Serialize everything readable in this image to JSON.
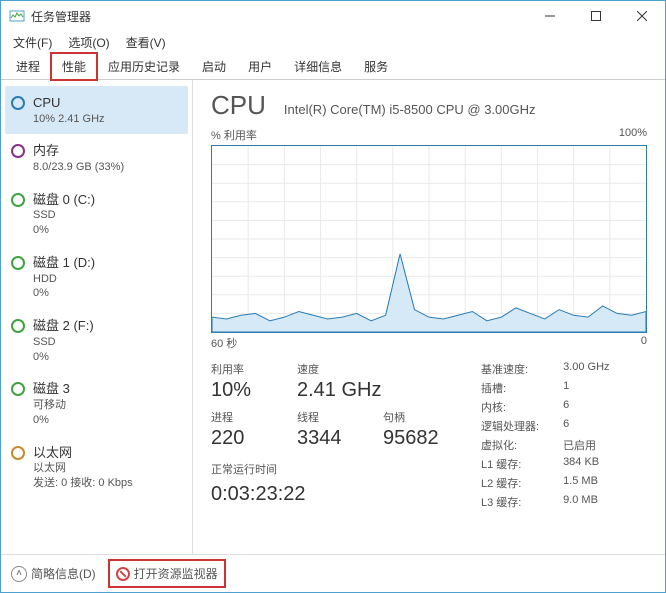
{
  "window": {
    "title": "任务管理器"
  },
  "menu": {
    "file": "文件(F)",
    "options": "选项(O)",
    "view": "查看(V)"
  },
  "tabs": {
    "processes": "进程",
    "performance": "性能",
    "apphistory": "应用历史记录",
    "startup": "启动",
    "users": "用户",
    "details": "详细信息",
    "services": "服务"
  },
  "sidebar": {
    "items": [
      {
        "title": "CPU",
        "sub": "10% 2.41 GHz",
        "color": "#2b7cb3"
      },
      {
        "title": "内存",
        "sub": "8.0/23.9 GB (33%)",
        "color": "#8a2e8a"
      },
      {
        "title": "磁盘 0 (C:)",
        "sub": "SSD",
        "sub2": "0%",
        "color": "#3fa33f"
      },
      {
        "title": "磁盘 1 (D:)",
        "sub": "HDD",
        "sub2": "0%",
        "color": "#3fa33f"
      },
      {
        "title": "磁盘 2 (F:)",
        "sub": "SSD",
        "sub2": "0%",
        "color": "#3fa33f"
      },
      {
        "title": "磁盘 3",
        "sub": "可移动",
        "sub2": "0%",
        "color": "#3fa33f"
      },
      {
        "title": "以太网",
        "sub": "以太网",
        "sub2": "发送: 0 接收: 0 Kbps",
        "color": "#c98a2b"
      }
    ]
  },
  "main": {
    "title": "CPU",
    "subtitle": "Intel(R) Core(TM) i5-8500 CPU @ 3.00GHz",
    "chart_label_left": "% 利用率",
    "chart_label_right": "100%",
    "chart_xaxis_left": "60 秒",
    "chart_xaxis_right": "0",
    "labels": {
      "util": "利用率",
      "speed": "速度",
      "procs": "进程",
      "threads": "线程",
      "handles": "句柄",
      "uptime": "正常运行时间"
    },
    "values": {
      "util": "10%",
      "speed": "2.41 GHz",
      "procs": "220",
      "threads": "3344",
      "handles": "95682",
      "uptime": "0:03:23:22"
    },
    "kvlabels": {
      "basespeed": "基准速度:",
      "sockets": "插槽:",
      "cores": "内核:",
      "logical": "逻辑处理器:",
      "virt": "虚拟化:",
      "l1": "L1 缓存:",
      "l2": "L2 缓存:",
      "l3": "L3 缓存:"
    },
    "kvvalues": {
      "basespeed": "3.00 GHz",
      "sockets": "1",
      "cores": "6",
      "logical": "6",
      "virt": "已启用",
      "l1": "384 KB",
      "l2": "1.5 MB",
      "l3": "9.0 MB"
    }
  },
  "footer": {
    "brief": "简略信息(D)",
    "resmon": "打开资源监视器"
  },
  "chart_data": {
    "type": "line",
    "title": "% 利用率",
    "xlabel": "60 秒 → 0",
    "ylabel": "% 利用率",
    "ylim": [
      0,
      100
    ],
    "x": [
      60,
      58,
      56,
      54,
      52,
      50,
      48,
      46,
      44,
      42,
      40,
      38,
      36,
      34,
      32,
      30,
      28,
      26,
      24,
      22,
      20,
      18,
      16,
      14,
      12,
      10,
      8,
      6,
      4,
      2,
      0
    ],
    "values": [
      8,
      7,
      9,
      10,
      6,
      8,
      11,
      9,
      7,
      8,
      10,
      6,
      9,
      42,
      12,
      8,
      7,
      9,
      11,
      6,
      8,
      13,
      10,
      7,
      12,
      9,
      8,
      14,
      10,
      9,
      11
    ]
  }
}
